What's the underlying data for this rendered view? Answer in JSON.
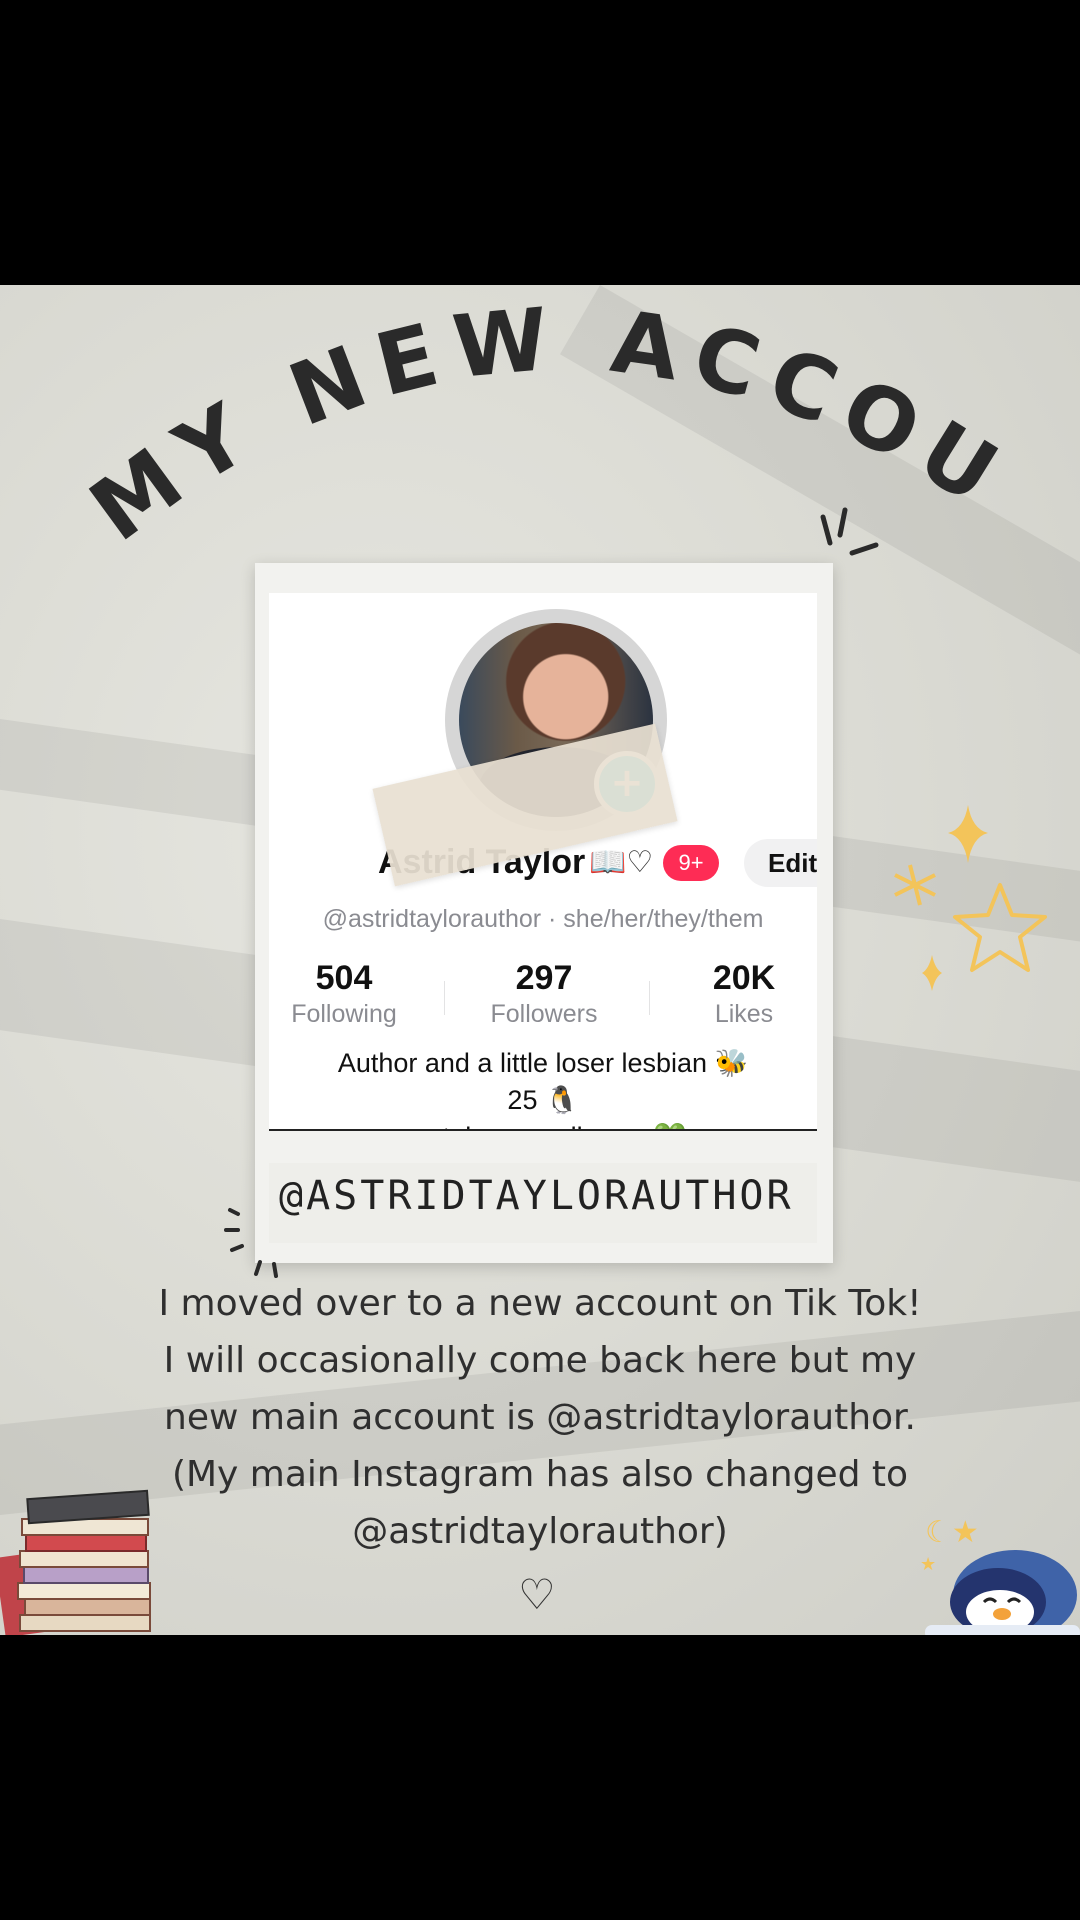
{
  "header": {
    "title": "MY NEW ACCOUNT"
  },
  "profile": {
    "name": "Astrid Taylor",
    "name_emoji": "📖♡",
    "notification_badge": "9+",
    "edit_label": "Edit",
    "handle_line": "@astridtaylorauthor · she/her/they/them",
    "stats": [
      {
        "value": "504",
        "label": "Following"
      },
      {
        "value": "297",
        "label": "Followers"
      },
      {
        "value": "20K",
        "label": "Likes"
      }
    ],
    "bio_lines": [
      "Author and a little loser lesbian 🐝",
      "25 🐧",
      "youtube • smallwooz 💚"
    ]
  },
  "caption": "@ASTRIDTAYLORAUTHOR",
  "message_lines": [
    "I moved over to a new account on Tik Tok!",
    "I will occasionally come back here but my",
    "new main account is @astridtaylorauthor.",
    "(My main Instagram has also changed to",
    "@astridtaylorauthor)"
  ],
  "closing_symbol": "♡",
  "colors": {
    "badge": "#fe2c55",
    "follow_plus": "#20d5ec",
    "sparkle": "#f3c45a"
  },
  "icons": {
    "plus": "+",
    "sparkles": "✦"
  }
}
